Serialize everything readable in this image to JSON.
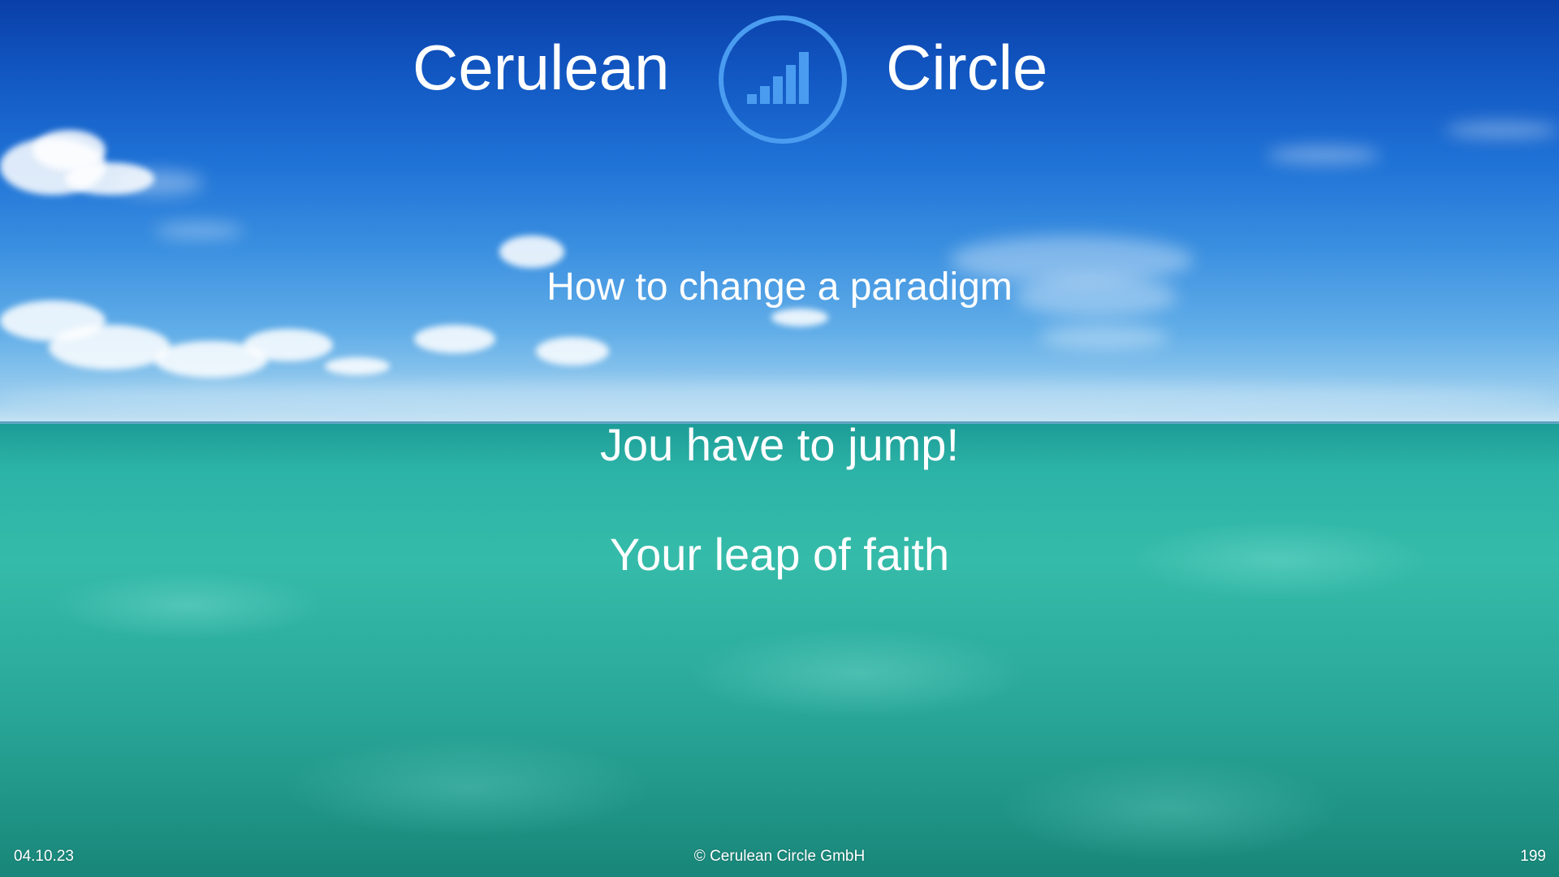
{
  "brand": {
    "word_left": "Cerulean",
    "word_right": "Circle",
    "logo_icon": "signal-bars-circle-icon",
    "logo_color": "#4a9cf0"
  },
  "content": {
    "line1": "How to change a paradigm",
    "line2": "Jou have to jump!",
    "line3": "Your leap of faith"
  },
  "footer": {
    "date": "04.10.23",
    "copyright": "© Cerulean Circle GmbH",
    "page_number": "199"
  },
  "colors": {
    "text": "#ffffff",
    "sky": "#1258c3",
    "sea": "#2cb3a7"
  }
}
